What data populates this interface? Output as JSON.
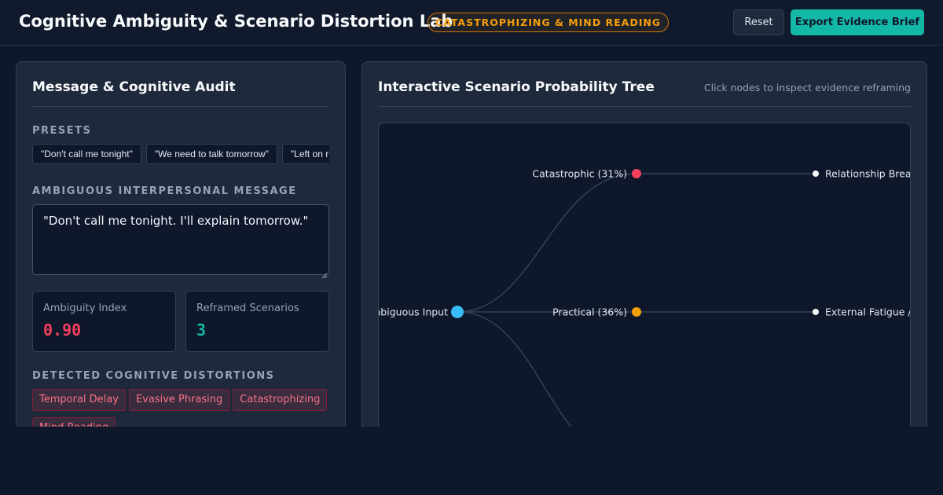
{
  "header": {
    "title": "Cognitive Ambiguity & Scenario Distortion Lab",
    "mode_badge": "CATASTROPHIZING & MIND READING",
    "reset_label": "Reset",
    "export_label": "Export Evidence Brief"
  },
  "audit_panel": {
    "title": "Message & Cognitive Audit",
    "presets_label": "PRESETS",
    "presets": [
      "\"Don't call me tonight\"",
      "\"We need to talk tomorrow\"",
      "\"Left on r"
    ],
    "message_label": "AMBIGUOUS INTERPERSONAL MESSAGE",
    "message_value": "\"Don't call me tonight. I'll explain tomorrow.\"",
    "ambiguity": {
      "label": "Ambiguity Index",
      "value": "0.90",
      "color": "#f43f5e"
    },
    "reframed": {
      "label": "Reframed Scenarios",
      "value": "3",
      "color": "#14b8a6"
    },
    "distortions_label": "DETECTED COGNITIVE DISTORTIONS",
    "distortions": [
      "Temporal Delay",
      "Evasive Phrasing",
      "Catastrophizing",
      "Mind Reading"
    ]
  },
  "tree_panel": {
    "title": "Interactive Scenario Probability Tree",
    "hint": "Click nodes to inspect evidence reframing",
    "root": {
      "label": "Ambiguous Input",
      "color": "#38bdf8"
    },
    "branches": [
      {
        "label": "Catastrophic (31%)",
        "color": "#f43f5e",
        "outcome": "Relationship Breakdown"
      },
      {
        "label": "Practical (36%)",
        "color": "#f59e0b",
        "outcome": "External Fatigue / Busy"
      }
    ]
  }
}
